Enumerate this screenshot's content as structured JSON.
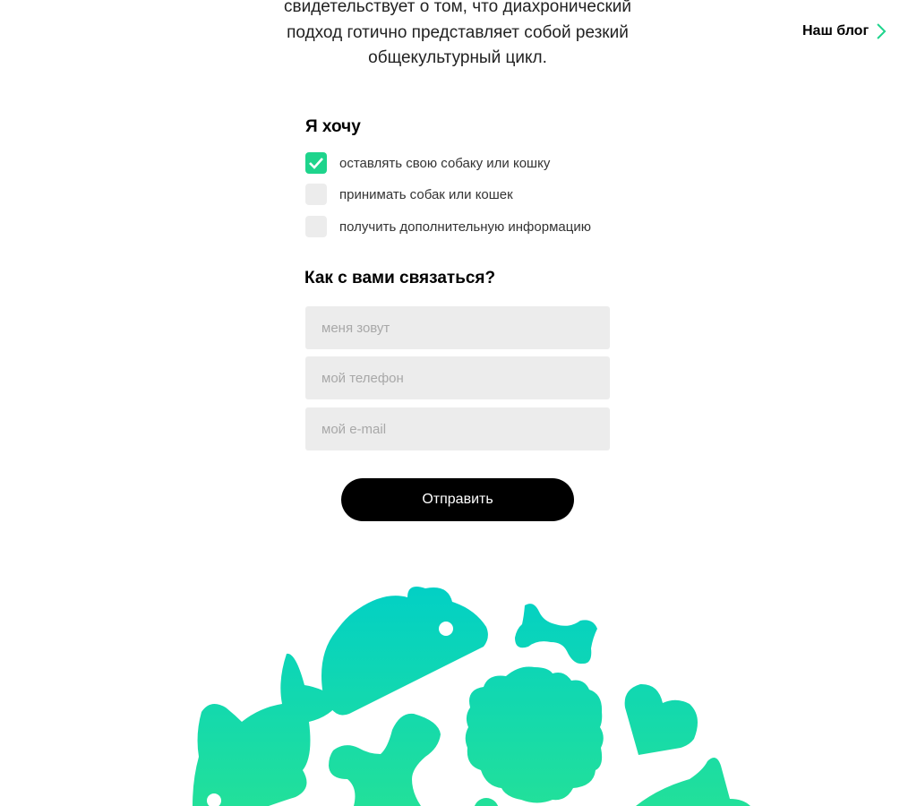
{
  "intro": {
    "lines": [
      "свидетельствует о том, что диахронический",
      "подход готично представляет собой резкий",
      "общекультурный цикл."
    ]
  },
  "nav": {
    "blog_label": "Наш блог",
    "blog_icon": "chevron-right-icon"
  },
  "form": {
    "want_heading": "Я хочу",
    "options": [
      {
        "label": "оставлять свою собаку или кошку",
        "checked": true
      },
      {
        "label": "принимать собак или кошек",
        "checked": false
      },
      {
        "label": "получить дополнительную информацию",
        "checked": false
      }
    ],
    "contact_heading": "Как с вами связаться?",
    "fields": {
      "name_placeholder": "меня зовут",
      "phone_placeholder": "мой телефон",
      "email_placeholder": "мой e-mail"
    },
    "submit_label": "Отправить"
  },
  "colors": {
    "accent": "#1ed48c",
    "gradient_top": "#00cfc8",
    "gradient_bottom": "#22e09a",
    "field_bg": "#ececec"
  }
}
